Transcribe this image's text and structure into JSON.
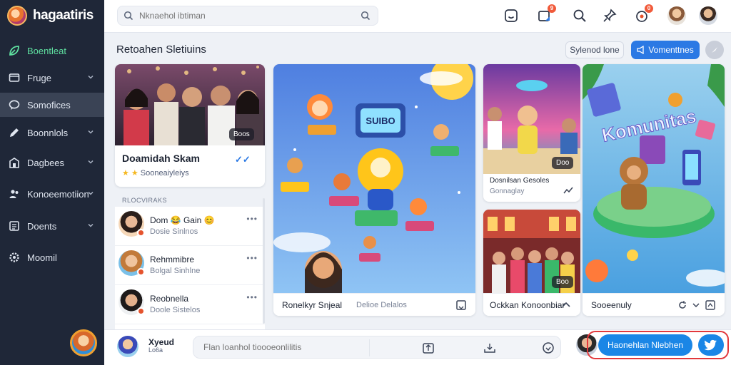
{
  "app": {
    "name": "hagaatiris"
  },
  "sidebar": {
    "items": [
      {
        "label": "Boentleat",
        "icon": "leaf-icon",
        "state": "active"
      },
      {
        "label": "Fruge",
        "icon": "folder-icon",
        "has_chevron": true
      },
      {
        "label": "Somofices",
        "icon": "chat-icon",
        "state": "selected"
      },
      {
        "label": "Boonnlols",
        "icon": "pen-icon",
        "has_chevron": true
      },
      {
        "label": "Dagbees",
        "icon": "building-icon",
        "has_chevron": true
      },
      {
        "label": "Konoeemotiion",
        "icon": "people-icon",
        "has_chevron": true
      },
      {
        "label": "Doents",
        "icon": "document-icon",
        "has_chevron": true
      },
      {
        "label": "Moomil",
        "icon": "settings-icon"
      }
    ]
  },
  "search": {
    "placeholder": "Nknaehol ibtiman"
  },
  "topbar": {
    "icons": [
      "smile-icon",
      "inbox-icon",
      "search-icon",
      "pin-icon",
      "notification-icon"
    ],
    "badges": {
      "inbox": "9",
      "notification": "0"
    }
  },
  "main": {
    "title": "Retoahen Sletiuins",
    "secondary_button": "Sylenod lone",
    "primary_button": "Vomenttnes"
  },
  "feature": {
    "title": "Doamidah Skam",
    "subtitle": "Sooneaiyleiys",
    "count": "Boos",
    "verified_mark": "✓✓"
  },
  "list": {
    "header": "RLOCVIRAKS",
    "items": [
      {
        "name": "Dom 😂 Gain 😊",
        "sub": "Dosie Sinlnos",
        "more": "•••"
      },
      {
        "name": "Rehmmibre",
        "sub": "Bolgal Sinhlne",
        "more": "•••"
      },
      {
        "name": "Reobnella",
        "sub": "Doole Sistelos",
        "more": "•••"
      }
    ]
  },
  "cards": {
    "big": {
      "title": "Ronelkyr Snjeal",
      "sub": "Delioe Delalos",
      "sign_text": "SUIBO"
    },
    "r1": {
      "title": "Dosnilsan Gesoles",
      "sub": "Gonnaglay",
      "count": "Doo"
    },
    "r2": {
      "title": "Ockkan Konoonbiar",
      "count": "Boo"
    },
    "r3": {
      "art_text": "Komunitas",
      "footer": "Sooeenuly"
    }
  },
  "bottombar": {
    "user_name": "Xyeud",
    "user_sub": "Lo6a",
    "composer_placeholder": "Flan loanhol tioooeonlilitis",
    "share_label": "Haonehlan Nlebhen"
  },
  "colors": {
    "sidebar_bg": "#1f2738",
    "accent_blue": "#2b79e4",
    "share_blue": "#1a86e6",
    "active_green": "#5fe0a0",
    "highlight_red": "#e2383b"
  }
}
